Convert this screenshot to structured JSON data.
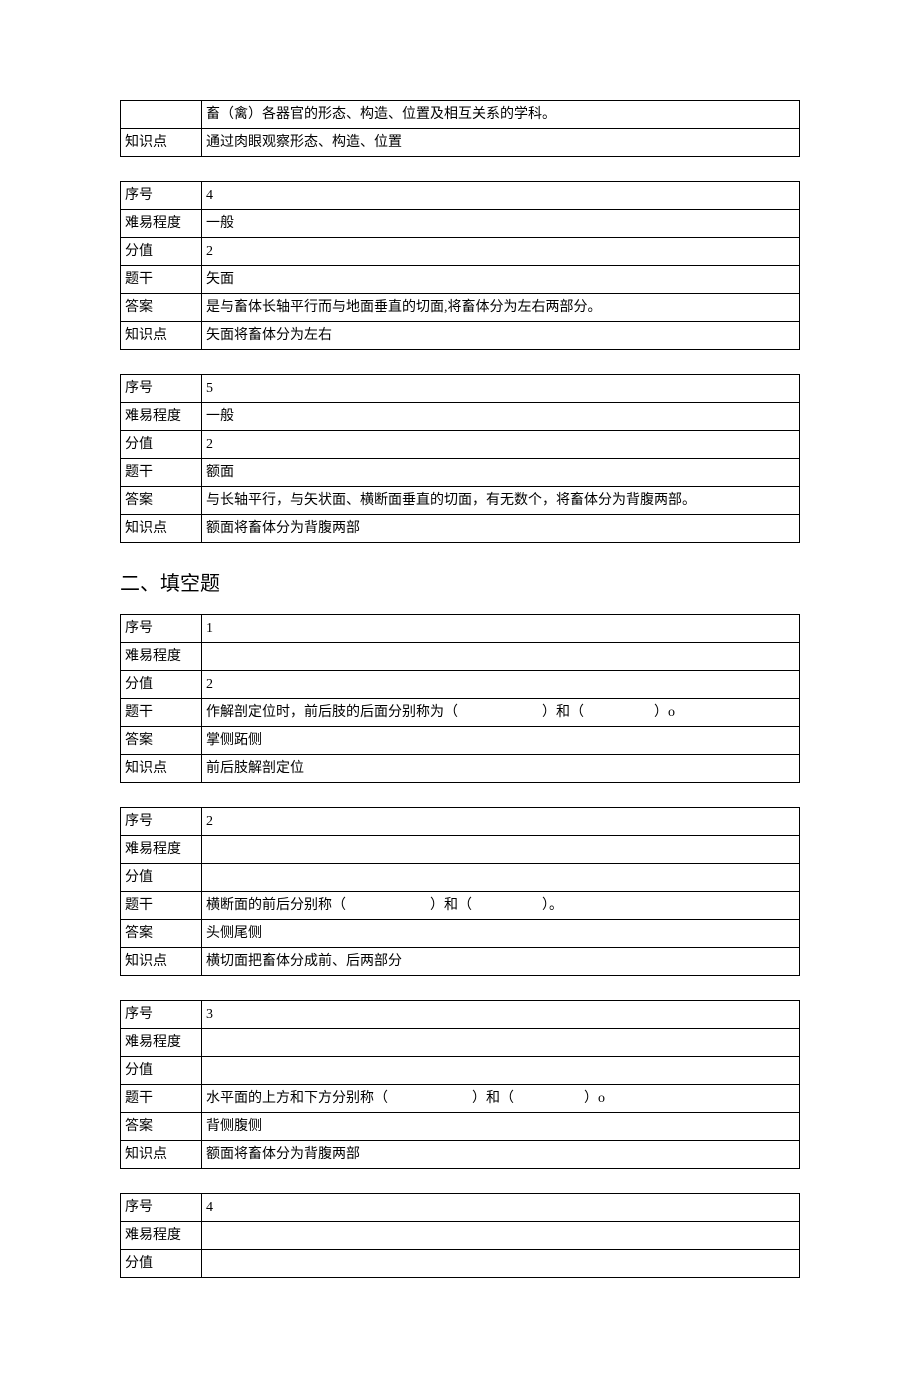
{
  "labels": {
    "seq": "序号",
    "difficulty": "难易程度",
    "score": "分值",
    "stem": "题干",
    "answer": "答案",
    "point": "知识点"
  },
  "table1": {
    "r1": "畜（禽）各器官的形态、构造、位置及相互关系的学科。",
    "point_label": "知识点",
    "point_value": "通过肉眼观察形态、构造、位置"
  },
  "table2": {
    "seq": "4",
    "difficulty": "一般",
    "score": "2",
    "stem": "矢面",
    "answer": "是与畜体长轴平行而与地面垂直的切面,将畜体分为左右两部分。",
    "point": "矢面将畜体分为左右"
  },
  "table3": {
    "seq": "5",
    "difficulty": "一般",
    "score": "2",
    "stem": "额面",
    "answer": "与长轴平行，与矢状面、横断面垂直的切面，有无数个，将畜体分为背腹两部。",
    "point": "额面将畜体分为背腹两部"
  },
  "section2": "二、填空题",
  "fill1": {
    "seq": "1",
    "difficulty": "",
    "score": "2",
    "stem": "作解剖定位时，前后肢的后面分别称为（　　　　　　）和（　　　　　）o",
    "answer": "掌侧跖侧",
    "point": "前后肢解剖定位"
  },
  "fill2": {
    "seq": "2",
    "difficulty": "",
    "score": "",
    "stem": "横断面的前后分别称（　　　　　　）和（　　　　　）。",
    "answer": "头侧尾侧",
    "point": "横切面把畜体分成前、后两部分"
  },
  "fill3": {
    "seq": "3",
    "difficulty": "",
    "score": "",
    "stem": "水平面的上方和下方分别称（　　　　　　）和（　　　　　）o",
    "answer": "背侧腹侧",
    "point": "额面将畜体分为背腹两部"
  },
  "fill4": {
    "seq": "4",
    "difficulty": "",
    "score": ""
  }
}
